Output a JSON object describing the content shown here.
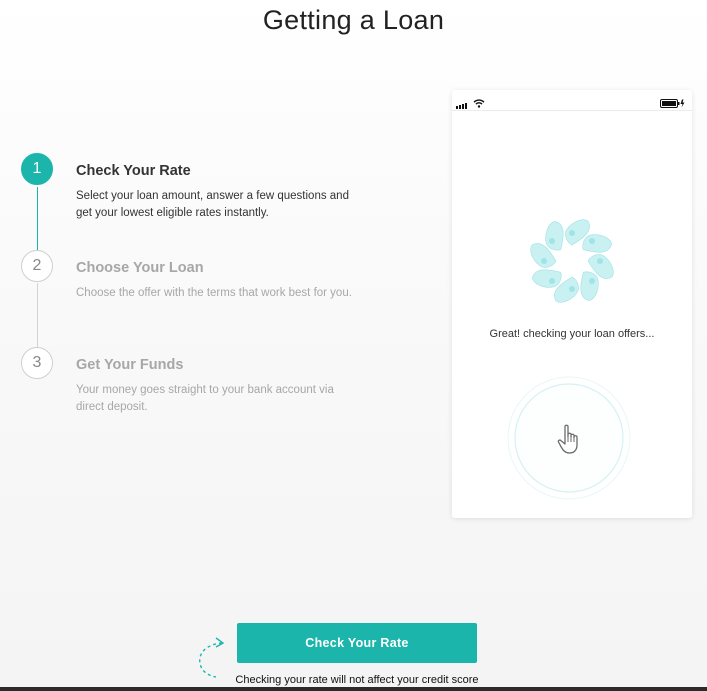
{
  "page": {
    "title": "Getting a Loan"
  },
  "steps": [
    {
      "number": "1",
      "title": "Check Your Rate",
      "description": "Select your loan amount, answer a few questions and get your lowest eligible rates instantly.",
      "state": "active"
    },
    {
      "number": "2",
      "title": "Choose Your Loan",
      "description": "Choose the offer with the terms that work best for you.",
      "state": "inactive"
    },
    {
      "number": "3",
      "title": "Get Your Funds",
      "description": "Your money goes straight to your bank account via direct deposit.",
      "state": "inactive"
    }
  ],
  "phone": {
    "status_icons": [
      "signal-icon",
      "wifi-icon",
      "battery-icon"
    ],
    "loader_icon": "pinwheel-loader-icon",
    "status_text": "Great! checking your loan offers...",
    "tap_icon": "pointing-hand-icon"
  },
  "cta": {
    "button_label": "Check Your Rate",
    "note": "Checking your rate will not affect your credit score",
    "arrow_icon": "dashed-arrow-icon"
  },
  "colors": {
    "accent": "#1cb5ac",
    "inactive_text": "#a7a7a7",
    "loader_petal": "#bfeef0"
  }
}
